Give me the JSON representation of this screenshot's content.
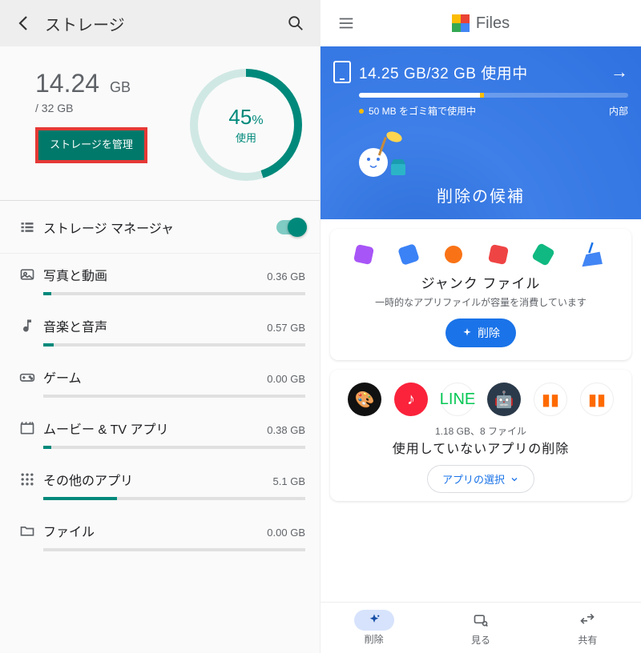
{
  "left": {
    "title": "ストレージ",
    "used_value": "14.24",
    "used_unit": "GB",
    "total": "/ 32 GB",
    "ring_pct": "45",
    "ring_pct_unit": "%",
    "ring_label": "使用",
    "manage_label": "ストレージを管理",
    "manager_row": "ストレージ マネージャ",
    "categories": [
      {
        "name": "写真と動画",
        "size": "0.36 GB",
        "fill": 3
      },
      {
        "name": "音楽と音声",
        "size": "0.57 GB",
        "fill": 4
      },
      {
        "name": "ゲーム",
        "size": "0.00 GB",
        "fill": 0
      },
      {
        "name": "ムービー & TV アプリ",
        "size": "0.38 GB",
        "fill": 3
      },
      {
        "name": "その他のアプリ",
        "size": "5.1 GB",
        "fill": 28
      },
      {
        "name": "ファイル",
        "size": "0.00 GB",
        "fill": 0
      }
    ]
  },
  "right": {
    "brand": "Files",
    "hero_usage": "14.25 GB/32 GB 使用中",
    "hero_trash": "50 MB をゴミ箱で使用中",
    "hero_internal": "内部",
    "hero_title": "削除の候補",
    "card_junk_title": "ジャンク ファイル",
    "card_junk_sub": "一時的なアプリファイルが容量を消費しています",
    "card_junk_btn": "削除",
    "card_unused_meta": "1.18 GB、8 ファイル",
    "card_unused_title": "使用していないアプリの削除",
    "card_unused_btn": "アプリの選択",
    "nav": {
      "clean": "削除",
      "browse": "見る",
      "share": "共有"
    }
  }
}
